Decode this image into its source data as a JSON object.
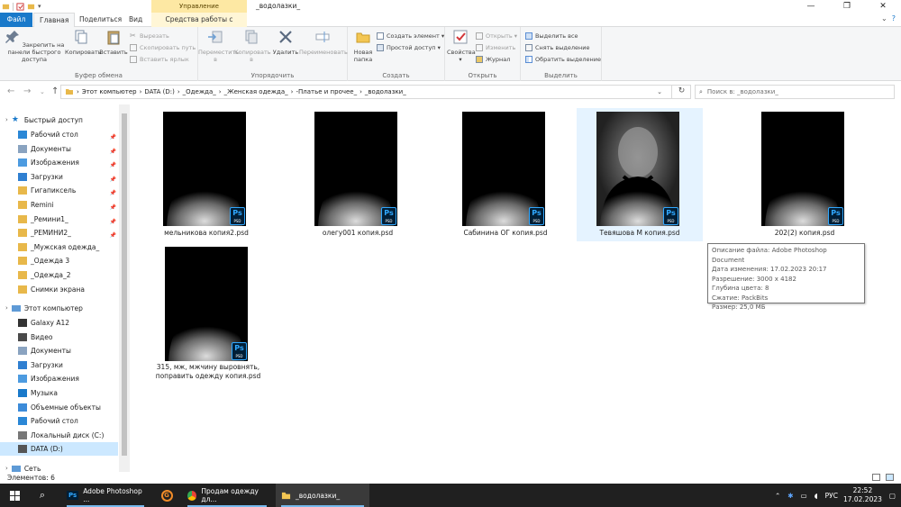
{
  "window": {
    "title": "_водолазки_",
    "context_band": "Управление"
  },
  "tabs": {
    "file": "Файл",
    "home": "Главная",
    "share": "Поделиться",
    "view": "Вид",
    "picture_tools": "Средства работы с рисунками"
  },
  "ribbon": {
    "clipboard": {
      "pin": "Закрепить на панели быстрого доступа",
      "copy": "Копировать",
      "paste": "Вставить",
      "cut": "Вырезать",
      "copy_path": "Скопировать путь",
      "paste_shortcut": "Вставить ярлык",
      "label": "Буфер обмена"
    },
    "organize": {
      "move": "Переместить в",
      "copyto": "Копировать в",
      "delete": "Удалить",
      "rename": "Переименовать",
      "label": "Упорядочить"
    },
    "new": {
      "new_folder": "Новая папка",
      "new_item": "Создать элемент",
      "easy_access": "Простой доступ",
      "label": "Создать"
    },
    "open": {
      "properties": "Свойства",
      "open": "Открыть",
      "edit": "Изменить",
      "history": "Журнал",
      "label": "Открыть"
    },
    "select": {
      "select_all": "Выделить все",
      "select_none": "Снять выделение",
      "invert": "Обратить выделение",
      "label": "Выделить"
    }
  },
  "address": {
    "crumbs": [
      "Этот компьютер",
      "DATA (D:)",
      "_Одежда_",
      "_Женская одежда_",
      "-Платье и прочее_",
      "_водолазки_"
    ],
    "search_placeholder": "Поиск в: _водолазки_"
  },
  "navpane": {
    "quick_access": "Быстрый доступ",
    "quick_items": [
      {
        "label": "Рабочий стол",
        "pinned": true
      },
      {
        "label": "Документы",
        "pinned": true
      },
      {
        "label": "Изображения",
        "pinned": true
      },
      {
        "label": "Загрузки",
        "pinned": true
      },
      {
        "label": "Гигапиксель",
        "pinned": true
      },
      {
        "label": "Remini",
        "pinned": true
      },
      {
        "label": "_Ремини1_",
        "pinned": true
      },
      {
        "label": "_РЕМИНИ2_",
        "pinned": true
      },
      {
        "label": "_Мужская одежда_",
        "pinned": false
      },
      {
        "label": "_Одежда 3",
        "pinned": false
      },
      {
        "label": "_Одежда_2",
        "pinned": false
      },
      {
        "label": "Снимки экрана",
        "pinned": false
      }
    ],
    "this_pc": "Этот компьютер",
    "pc_items": [
      "Galaxy A12",
      "Видео",
      "Документы",
      "Загрузки",
      "Изображения",
      "Музыка",
      "Объемные объекты",
      "Рабочий стол",
      "Локальный диск (C:)",
      "DATA (D:)"
    ],
    "network": "Сеть"
  },
  "files": [
    {
      "name": "мельникова копия2.psd"
    },
    {
      "name": "олегу001 копия.psd"
    },
    {
      "name": "Сабинина ОГ копия.psd"
    },
    {
      "name": "Тевяшова М копия.psd"
    },
    {
      "name": "202(2) копия.psd"
    },
    {
      "name": "315, мж, мжчину выровнять, поправить одежду копия.psd"
    }
  ],
  "tooltip": {
    "lines": [
      "Описание файла: Adobe Photoshop Document",
      "Дата изменения: 17.02.2023 20:17",
      "Разрешение: 3000 x 4182",
      "Глубина цвета: 8",
      "Сжатие: PackBits",
      "Размер: 25,0 МБ"
    ]
  },
  "status": {
    "items_count": "Элементов: 6"
  },
  "taskbar": {
    "apps": [
      "Adobe Photoshop ...",
      "Продам одежду дл...",
      "_водолазки_"
    ],
    "lang": "РУС",
    "time": "22:52",
    "date": "17.02.2023"
  },
  "colors": {
    "accent": "#1979ca",
    "hover": "#e5f3ff",
    "selected": "#cce8ff",
    "taskbar": "#202020",
    "ps": "#31a8ff"
  }
}
